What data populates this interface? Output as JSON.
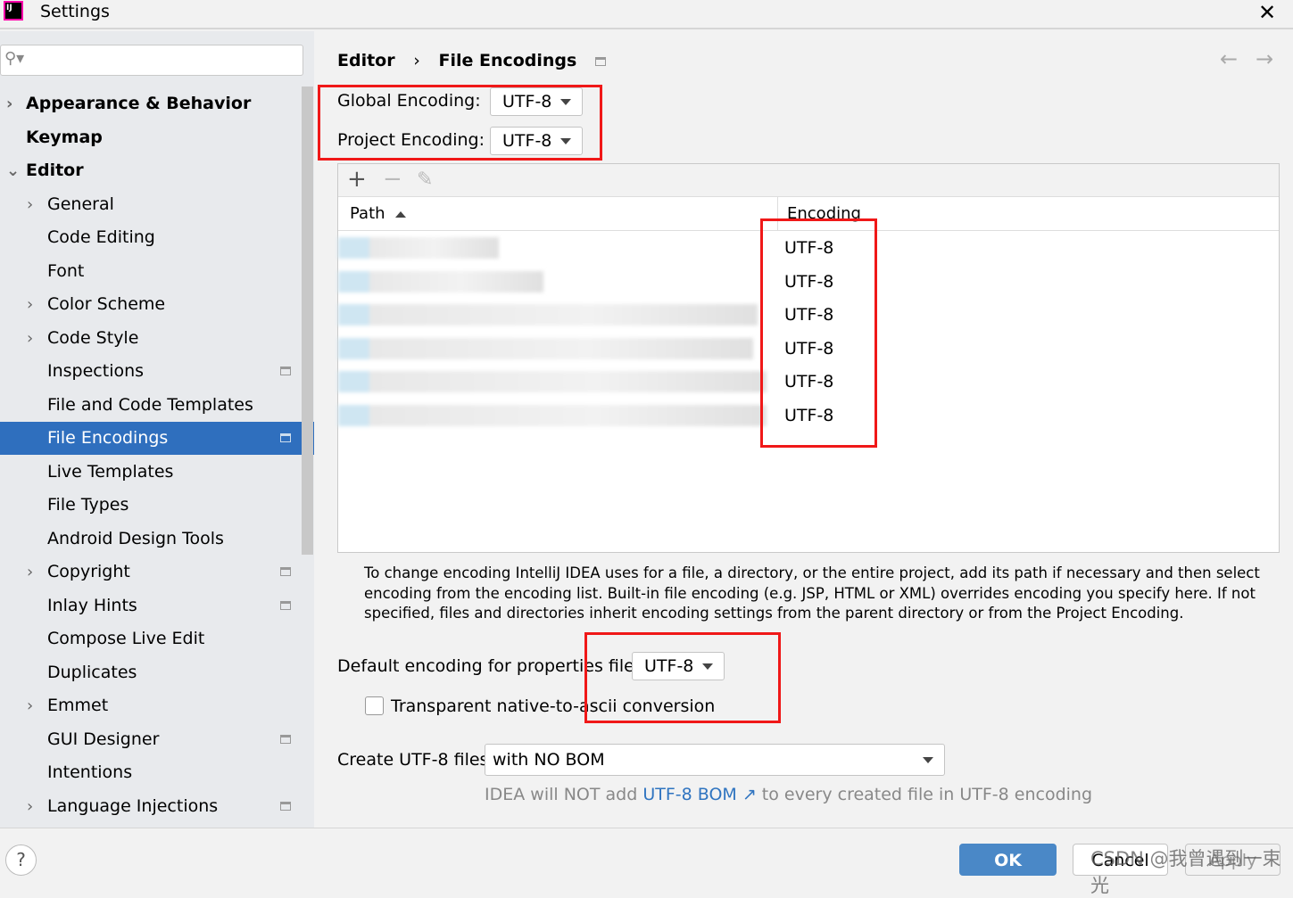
{
  "window": {
    "title": "Settings",
    "logo_text": "IJ",
    "close": "✕"
  },
  "sidebar": {
    "items": [
      {
        "label": "Appearance & Behavior",
        "chev": "›",
        "bold": true
      },
      {
        "label": "Keymap",
        "bold": true
      },
      {
        "label": "Editor",
        "chev": "⌄",
        "bold": true
      },
      {
        "label": "General",
        "chev": "›"
      },
      {
        "label": "Code Editing"
      },
      {
        "label": "Font"
      },
      {
        "label": "Color Scheme",
        "chev": "›"
      },
      {
        "label": "Code Style",
        "chev": "›"
      },
      {
        "label": "Inspections",
        "badge": true
      },
      {
        "label": "File and Code Templates"
      },
      {
        "label": "File Encodings",
        "badge": true,
        "selected": true
      },
      {
        "label": "Live Templates"
      },
      {
        "label": "File Types"
      },
      {
        "label": "Android Design Tools"
      },
      {
        "label": "Copyright",
        "chev": "›",
        "badge": true
      },
      {
        "label": "Inlay Hints",
        "badge": true
      },
      {
        "label": "Compose Live Edit"
      },
      {
        "label": "Duplicates"
      },
      {
        "label": "Emmet",
        "chev": "›"
      },
      {
        "label": "GUI Designer",
        "badge": true
      },
      {
        "label": "Intentions"
      },
      {
        "label": "Language Injections",
        "chev": "›",
        "badge": true
      }
    ]
  },
  "breadcrumb": {
    "parent": "Editor",
    "sep": "›",
    "current": "File Encodings"
  },
  "global_encoding": {
    "label": "Global Encoding:",
    "value": "UTF-8"
  },
  "project_encoding": {
    "label": "Project Encoding:",
    "value": "UTF-8"
  },
  "table": {
    "toolbar": {
      "add": "+",
      "remove": "−",
      "edit": "✎"
    },
    "columns": [
      "Path",
      "Encoding"
    ],
    "rows": [
      "UTF-8",
      "UTF-8",
      "UTF-8",
      "UTF-8",
      "UTF-8",
      "UTF-8"
    ]
  },
  "help_text": "To change encoding IntelliJ IDEA uses for a file, a directory, or the entire project, add its path if necessary and then select encoding from the encoding list. Built-in file encoding (e.g. JSP, HTML or XML) overrides encoding you specify here. If not specified, files and directories inherit encoding settings from the parent directory or from the Project Encoding.",
  "properties": {
    "label": "Default encoding for properties files:",
    "value": "UTF-8"
  },
  "native_ascii": {
    "label": "Transparent native-to-ascii conversion",
    "checked": false
  },
  "create_utf8": {
    "label": "Create UTF-8 files:",
    "value": "with NO BOM"
  },
  "hint": {
    "pre": "IDEA will NOT add ",
    "link": "UTF-8 BOM ↗",
    "post": " to every created file in UTF-8 encoding"
  },
  "buttons": {
    "ok": "OK",
    "cancel": "Cancel",
    "apply": "Apply",
    "help": "?"
  },
  "watermark": "CSDN @我曾遇到一束光"
}
